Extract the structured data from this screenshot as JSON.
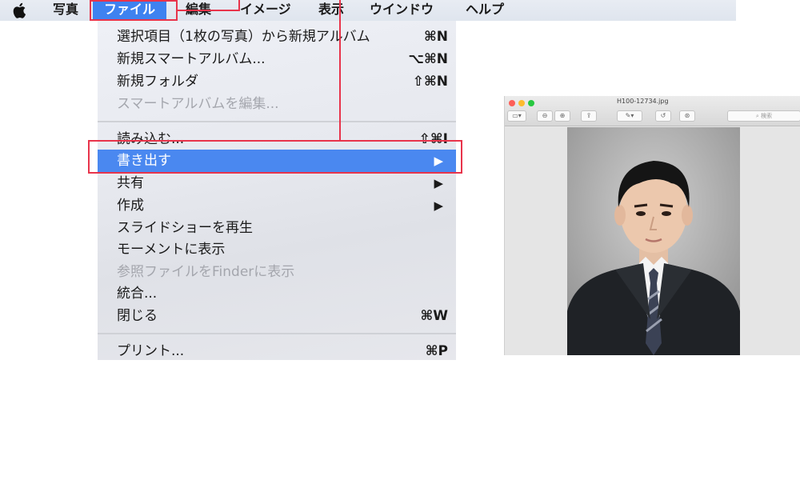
{
  "menubar": {
    "items": [
      {
        "label": "写真"
      },
      {
        "label": "ファイル"
      },
      {
        "label": "編集"
      },
      {
        "label": "イメージ"
      },
      {
        "label": "表示"
      },
      {
        "label": "ウインドウ"
      },
      {
        "label": "ヘルプ"
      }
    ]
  },
  "file_menu": {
    "items": [
      {
        "label": "選択項目（1枚の写真）から新規アルバム",
        "shortcut": "⌘N"
      },
      {
        "label": "新規スマートアルバム...",
        "shortcut": "⌥⌘N"
      },
      {
        "label": "新規フォルダ",
        "shortcut": "⇧⌘N"
      },
      {
        "label": "スマートアルバムを編集...",
        "disabled": true
      },
      {
        "label": "読み込む...",
        "shortcut": "⇧⌘I"
      },
      {
        "label": "書き出す",
        "submenu": true,
        "highlighted": true
      },
      {
        "label": "共有",
        "submenu": true
      },
      {
        "label": "作成",
        "submenu": true
      },
      {
        "label": "スライドショーを再生"
      },
      {
        "label": "モーメントに表示"
      },
      {
        "label": "参照ファイルをFinderに表示",
        "disabled": true
      },
      {
        "label": "統合..."
      },
      {
        "label": "閉じる",
        "shortcut": "⌘W"
      },
      {
        "label": "プリント...",
        "shortcut": "⌘P"
      }
    ],
    "submenu_arrow": "▶"
  },
  "preview_window": {
    "title": "H100-12734.jpg",
    "search_placeholder": "検索"
  },
  "colors": {
    "accent": "#3e82f0",
    "annotation": "#e8344b"
  }
}
